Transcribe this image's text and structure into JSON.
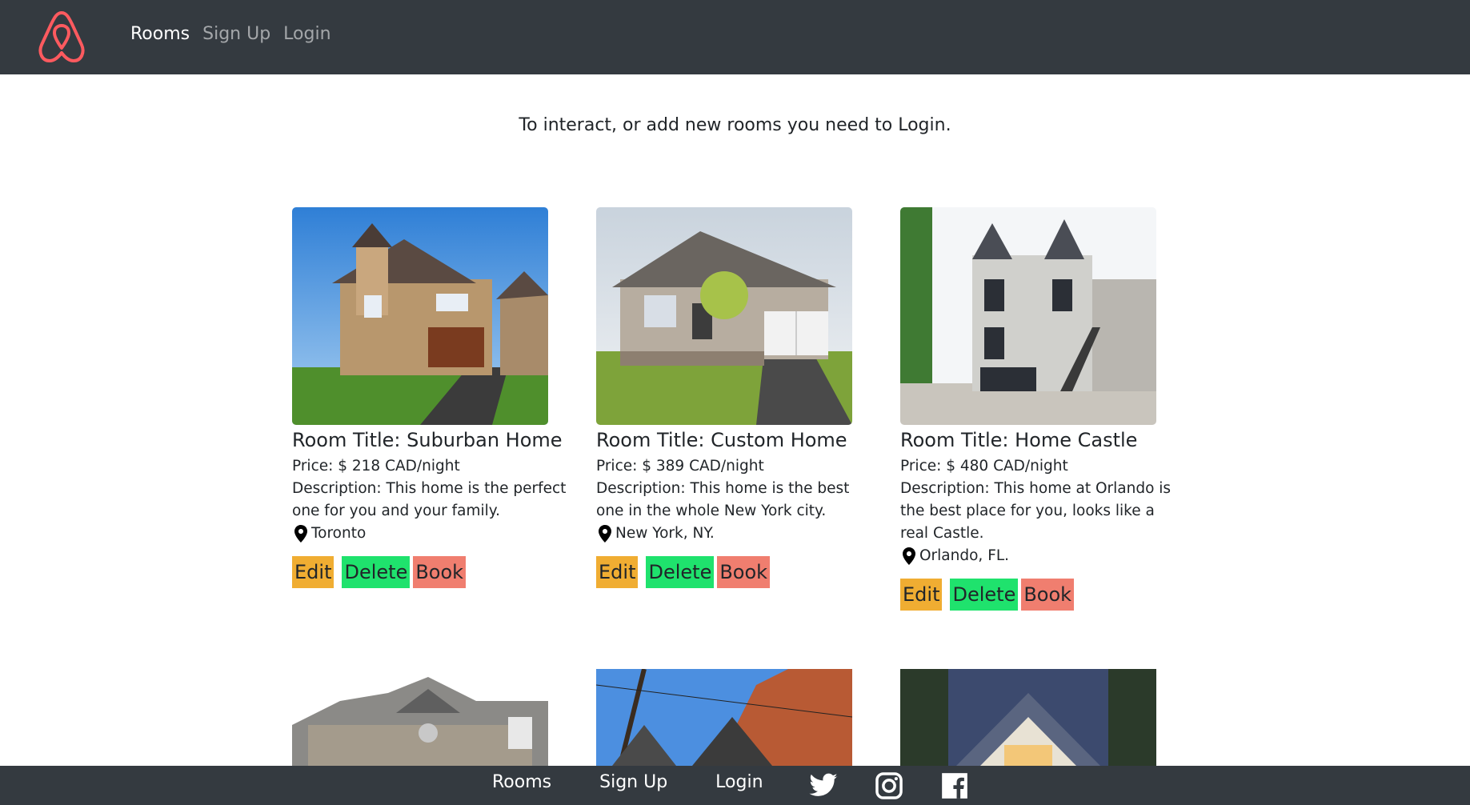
{
  "nav": {
    "logo": "airbnb-logo",
    "links": [
      "Rooms",
      "Sign Up",
      "Login"
    ]
  },
  "notice": "To interact, or add new rooms you need to Login.",
  "rooms": [
    {
      "title": "Room Title: Suburban Home",
      "price": "Price: $ 218 CAD/night",
      "description": "Description: This home is the perfect one for you and your family.",
      "location": "Toronto",
      "edit_label": "Edit",
      "delete_label": "Delete",
      "book_label": "Book"
    },
    {
      "title": "Room Title: Custom Home",
      "price": "Price: $ 389 CAD/night",
      "description": "Description: This home is the best one in the whole New York city.",
      "location": "New York, NY.",
      "edit_label": "Edit",
      "delete_label": "Delete",
      "book_label": "Book"
    },
    {
      "title": "Room Title: Home Castle",
      "price": "Price: $ 480 CAD/night",
      "description": "Description: This home at Orlando is the best place for you, looks like a real Castle.",
      "location": "Orlando, FL.",
      "edit_label": "Edit",
      "delete_label": "Delete",
      "book_label": "Book"
    }
  ],
  "footer": {
    "links": [
      "Rooms",
      "Sign Up",
      "Login"
    ],
    "icons": [
      "twitter-icon",
      "instagram-icon",
      "facebook-icon"
    ]
  },
  "colors": {
    "navbar": "#343a40",
    "brand": "#ff5a5f",
    "edit": "#f0ad32",
    "delete": "#1fe26d",
    "book": "#f07e6f"
  }
}
